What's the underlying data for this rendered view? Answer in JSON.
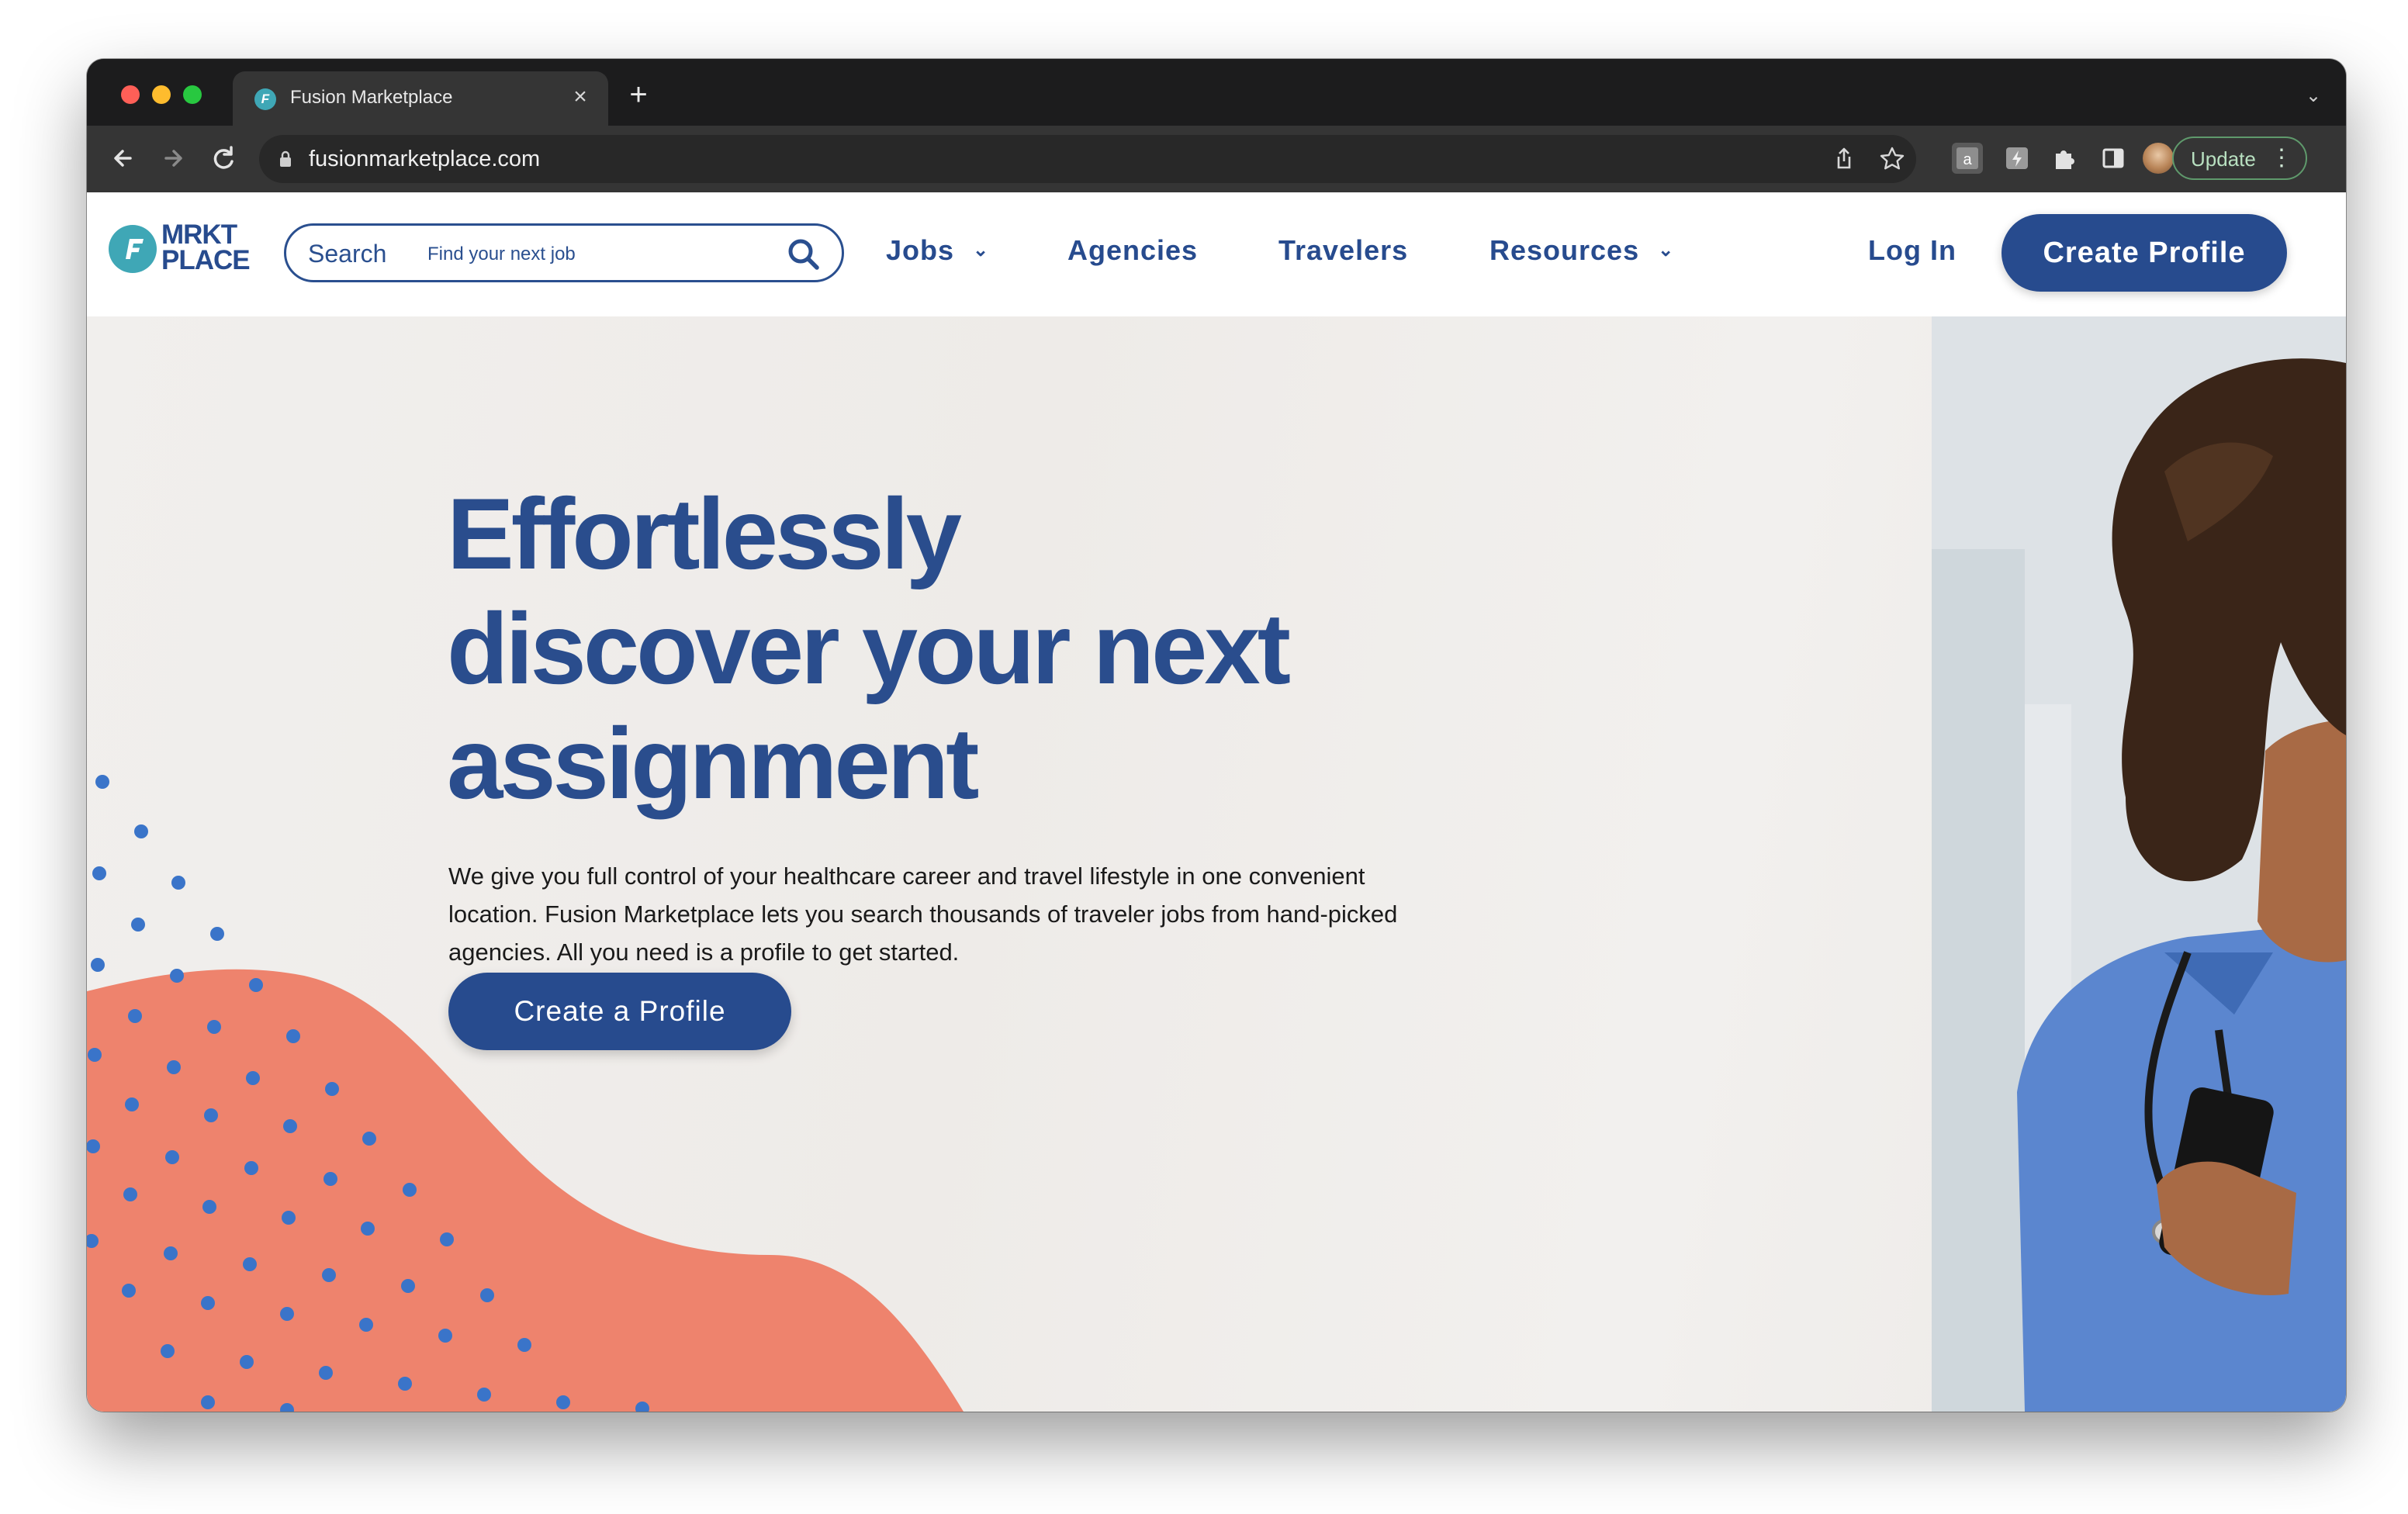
{
  "browser": {
    "tab_title": "Fusion Marketplace",
    "url": "fusionmarketplace.com",
    "update_label": "Update"
  },
  "header": {
    "logo_line1": "MRKT",
    "logo_line2": "PLACE",
    "search_label": "Search",
    "search_placeholder": "Find your next job",
    "nav": {
      "jobs": "Jobs",
      "agencies": "Agencies",
      "travelers": "Travelers",
      "resources": "Resources"
    },
    "login": "Log In",
    "create_profile": "Create Profile"
  },
  "hero": {
    "title_line1": "Effortlessly",
    "title_line2": "discover your next",
    "title_line3": "assignment",
    "description": "We give you full control of your healthcare career and travel lifestyle in one convenient location. Fusion Marketplace lets you search thousands of traveler jobs from hand-picked agencies. All you need is a profile to get started.",
    "cta": "Create a Profile"
  },
  "colors": {
    "brand_navy": "#274b8e",
    "brand_teal": "#3fa7b6",
    "accent_coral": "#ee836d",
    "dot_blue": "#3a74c9"
  }
}
